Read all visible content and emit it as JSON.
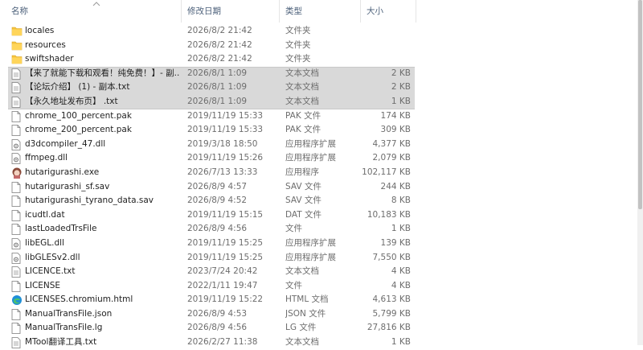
{
  "columns": {
    "name": "名称",
    "date": "修改日期",
    "type": "类型",
    "size": "大小"
  },
  "sort": {
    "column": "name",
    "direction": "ascending",
    "icon": "sort-up-caret-icon"
  },
  "files": [
    {
      "name": "locales",
      "date": "2026/8/2 21:42",
      "type": "文件夹",
      "size": "",
      "icon": "folder-icon",
      "selected": false
    },
    {
      "name": "resources",
      "date": "2026/8/2 21:42",
      "type": "文件夹",
      "size": "",
      "icon": "folder-icon",
      "selected": false
    },
    {
      "name": "swiftshader",
      "date": "2026/8/2 21:42",
      "type": "文件夹",
      "size": "",
      "icon": "folder-icon",
      "selected": false
    },
    {
      "name": "【来了就能下载和观看！纯免费！】- 副...",
      "date": "2026/8/1 1:09",
      "type": "文本文档",
      "size": "2 KB",
      "icon": "text-file-icon",
      "selected": true
    },
    {
      "name": "【论坛介绍】 (1) - 副本.txt",
      "date": "2026/8/1 1:09",
      "type": "文本文档",
      "size": "2 KB",
      "icon": "text-file-icon",
      "selected": true
    },
    {
      "name": "【永久地址发布页】 .txt",
      "date": "2026/8/1 1:09",
      "type": "文本文档",
      "size": "1 KB",
      "icon": "text-file-icon",
      "selected": true
    },
    {
      "name": "chrome_100_percent.pak",
      "date": "2019/11/19 15:33",
      "type": "PAK 文件",
      "size": "174 KB",
      "icon": "file-icon",
      "selected": false
    },
    {
      "name": "chrome_200_percent.pak",
      "date": "2019/11/19 15:33",
      "type": "PAK 文件",
      "size": "309 KB",
      "icon": "file-icon",
      "selected": false
    },
    {
      "name": "d3dcompiler_47.dll",
      "date": "2019/3/18 18:50",
      "type": "应用程序扩展",
      "size": "4,377 KB",
      "icon": "dll-file-icon",
      "selected": false
    },
    {
      "name": "ffmpeg.dll",
      "date": "2019/11/19 15:26",
      "type": "应用程序扩展",
      "size": "2,079 KB",
      "icon": "dll-file-icon",
      "selected": false
    },
    {
      "name": "hutarigurashi.exe",
      "date": "2026/7/13 13:33",
      "type": "应用程序",
      "size": "102,117 KB",
      "icon": "app-exe-icon",
      "selected": false
    },
    {
      "name": "hutarigurashi_sf.sav",
      "date": "2026/8/9 4:57",
      "type": "SAV 文件",
      "size": "244 KB",
      "icon": "file-icon",
      "selected": false
    },
    {
      "name": "hutarigurashi_tyrano_data.sav",
      "date": "2026/8/9 4:52",
      "type": "SAV 文件",
      "size": "8 KB",
      "icon": "file-icon",
      "selected": false
    },
    {
      "name": "icudtl.dat",
      "date": "2019/11/19 15:15",
      "type": "DAT 文件",
      "size": "10,183 KB",
      "icon": "file-icon",
      "selected": false
    },
    {
      "name": "lastLoadedTrsFile",
      "date": "2026/8/9 4:56",
      "type": "文件",
      "size": "1 KB",
      "icon": "file-icon",
      "selected": false
    },
    {
      "name": "libEGL.dll",
      "date": "2019/11/19 15:25",
      "type": "应用程序扩展",
      "size": "139 KB",
      "icon": "dll-file-icon",
      "selected": false
    },
    {
      "name": "libGLESv2.dll",
      "date": "2019/11/19 15:25",
      "type": "应用程序扩展",
      "size": "7,550 KB",
      "icon": "dll-file-icon",
      "selected": false
    },
    {
      "name": "LICENCE.txt",
      "date": "2023/7/24 20:42",
      "type": "文本文档",
      "size": "4 KB",
      "icon": "text-file-icon",
      "selected": false
    },
    {
      "name": "LICENSE",
      "date": "2022/1/11 19:47",
      "type": "文件",
      "size": "4 KB",
      "icon": "file-icon",
      "selected": false
    },
    {
      "name": "LICENSES.chromium.html",
      "date": "2019/11/19 15:22",
      "type": "HTML 文档",
      "size": "4,613 KB",
      "icon": "edge-html-icon",
      "selected": false
    },
    {
      "name": "ManualTransFile.json",
      "date": "2026/8/9 4:53",
      "type": "JSON 文件",
      "size": "5,799 KB",
      "icon": "file-icon",
      "selected": false
    },
    {
      "name": "ManualTransFile.lg",
      "date": "2026/8/9 4:56",
      "type": "LG 文件",
      "size": "27,816 KB",
      "icon": "file-icon",
      "selected": false
    },
    {
      "name": "MTool翻译工具.txt",
      "date": "2026/2/27 11:38",
      "type": "文本文档",
      "size": "1 KB",
      "icon": "text-file-icon",
      "selected": false
    }
  ]
}
